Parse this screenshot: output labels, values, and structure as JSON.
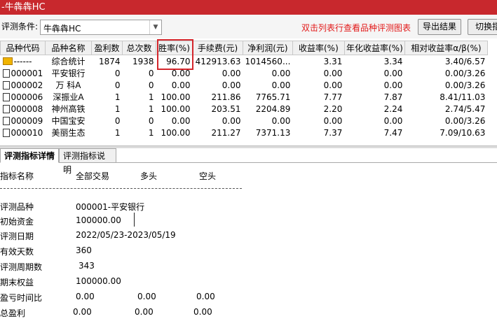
{
  "window": {
    "title": "-牛犇犇HC"
  },
  "toolbar": {
    "condition_label": "评测条件:",
    "condition_value": "牛犇犇HC",
    "hint": "双击列表行查看品种评测图表",
    "export_label": "导出结果",
    "switch_label": "切换指"
  },
  "grid": {
    "columns": [
      "品种代码",
      "品种名称",
      "盈利数",
      "总次数",
      "胜率(%)",
      "手续费(元)",
      "净利润(元)",
      "收益率(%)",
      "年化收益率(%)",
      "相对收益率α/β(%)"
    ],
    "rows": [
      [
        "------",
        "综合统计",
        "1874",
        "1938",
        "96.70",
        "412913.63",
        "1014560...",
        "3.31",
        "3.34",
        "3.40/6.57"
      ],
      [
        "000001",
        "平安银行",
        "0",
        "0",
        "0.00",
        "0.00",
        "0.00",
        "0.00",
        "0.00",
        "0.00/3.26"
      ],
      [
        "000002",
        "万 科A",
        "0",
        "0",
        "0.00",
        "0.00",
        "0.00",
        "0.00",
        "0.00",
        "0.00/3.26"
      ],
      [
        "000006",
        "深振业A",
        "1",
        "1",
        "100.00",
        "211.86",
        "7765.71",
        "7.77",
        "7.87",
        "8.41/11.03"
      ],
      [
        "000008",
        "神州高铁",
        "1",
        "1",
        "100.00",
        "203.51",
        "2204.89",
        "2.20",
        "2.24",
        "2.74/5.47"
      ],
      [
        "000009",
        "中国宝安",
        "0",
        "0",
        "0.00",
        "0.00",
        "0.00",
        "0.00",
        "0.00",
        "0.00/3.26"
      ],
      [
        "000010",
        "美丽生态",
        "1",
        "1",
        "100.00",
        "211.27",
        "7371.13",
        "7.37",
        "7.47",
        "7.09/10.63"
      ]
    ]
  },
  "tabs": {
    "detail": "评测指标详情",
    "explain": "评测指标说明"
  },
  "detail": {
    "headers": {
      "name": "指标名称",
      "all": "全部交易",
      "long": "多头",
      "short": "空头"
    },
    "rows": [
      {
        "label": "评测品种",
        "all": "000001-平安银行",
        "long": "",
        "short": ""
      },
      {
        "label": "初始资金",
        "all": "100000.00",
        "long": "",
        "short": ""
      },
      {
        "label": "评测日期",
        "all": "2022/05/23-2023/05/19",
        "long": "",
        "short": ""
      },
      {
        "label": "有效天数",
        "all": "360",
        "long": "",
        "short": ""
      },
      {
        "label": "评测周期数",
        "all": "343",
        "long": "",
        "short": ""
      },
      {
        "label": "期末权益",
        "all": "100000.00",
        "long": "",
        "short": ""
      },
      {
        "label": "盈亏时间比",
        "all": "0.00",
        "long": "0.00",
        "short": "0.00"
      },
      {
        "label": "总盈利",
        "all": "0.00",
        "long": "0.00",
        "short": "0.00"
      }
    ]
  },
  "colors": {
    "titlebar": "#c8282d",
    "hint": "#e21a1a",
    "highlight_box": "#d4262c",
    "summary_icon": "#f0b400"
  }
}
